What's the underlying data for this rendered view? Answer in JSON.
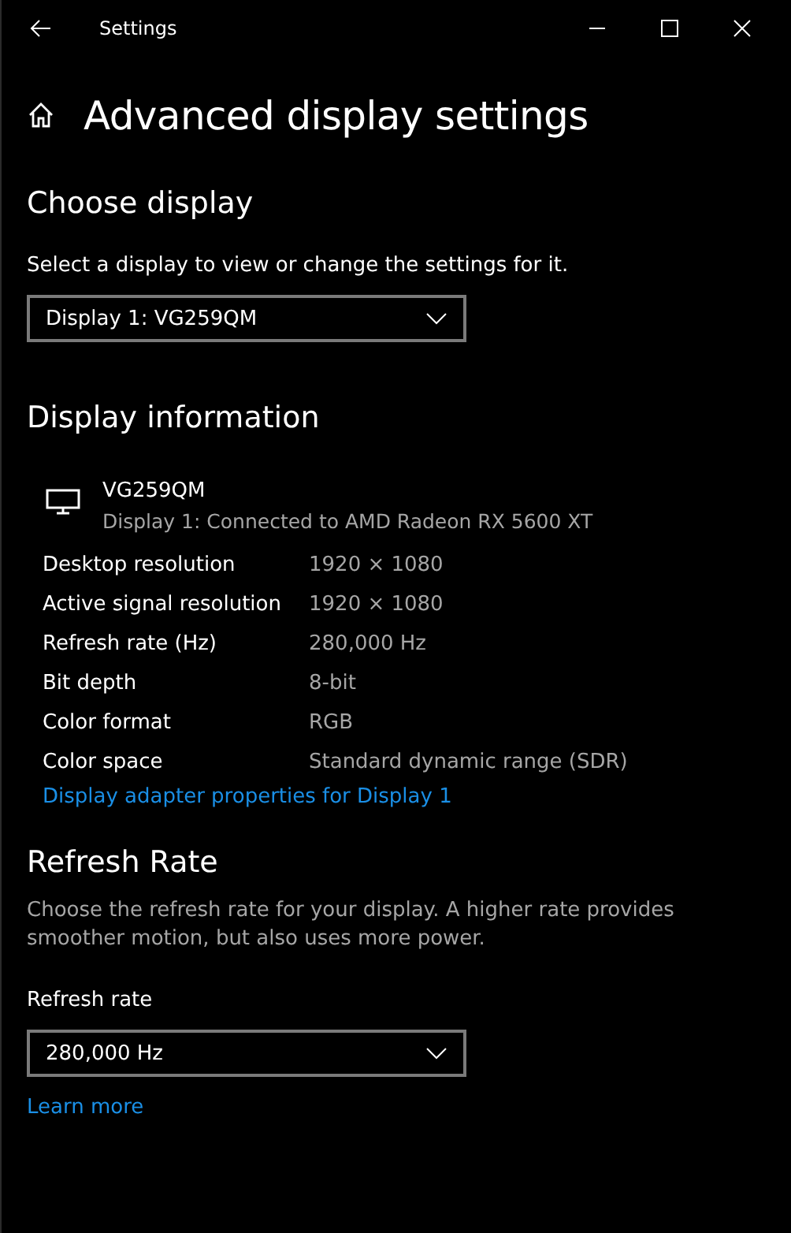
{
  "window": {
    "title": "Settings"
  },
  "page_title": "Advanced display settings",
  "choose_display": {
    "heading": "Choose display",
    "instruction": "Select a display to view or change the settings for it.",
    "dropdown": {
      "value": "Display 1: VG259QM"
    }
  },
  "display_information": {
    "heading": "Display information",
    "monitor": {
      "name": "VG259QM",
      "description": "Display 1: Connected to AMD Radeon RX 5600 XT"
    },
    "rows": [
      {
        "label": "Desktop resolution",
        "value": "1920 × 1080"
      },
      {
        "label": "Active signal resolution",
        "value": "1920 × 1080"
      },
      {
        "label": "Refresh rate (Hz)",
        "value": "280,000 Hz"
      },
      {
        "label": "Bit depth",
        "value": "8-bit"
      },
      {
        "label": "Color format",
        "value": "RGB"
      },
      {
        "label": "Color space",
        "value": "Standard dynamic range (SDR)"
      }
    ],
    "link": "Display adapter properties for Display 1"
  },
  "refresh_rate": {
    "heading": "Refresh Rate",
    "description": "Choose the refresh rate for your display. A higher rate provides smoother motion, but also uses more power.",
    "label": "Refresh rate",
    "dropdown": {
      "value": "280,000 Hz"
    },
    "link": "Learn more"
  }
}
